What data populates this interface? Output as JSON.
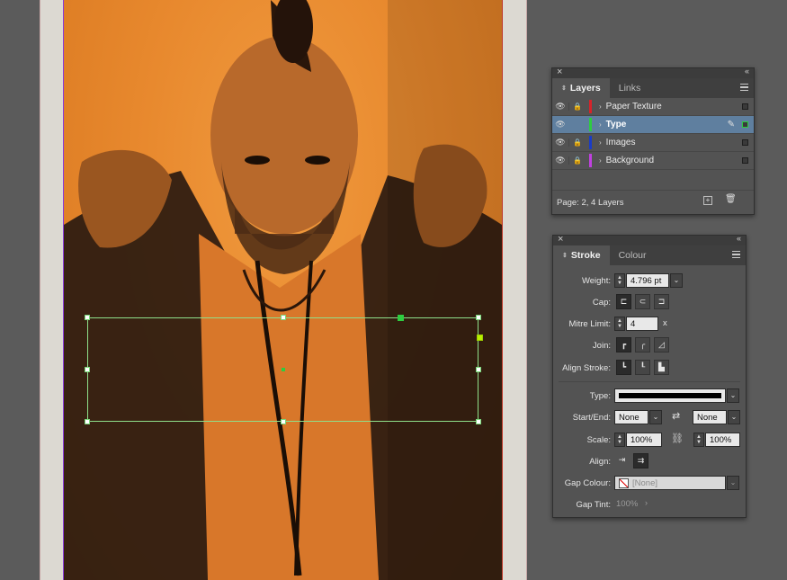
{
  "layers_panel": {
    "tabs": [
      "Layers",
      "Links"
    ],
    "active_tab": "Layers",
    "layers": [
      {
        "name": "Paper Texture",
        "color": "#d8232a",
        "visible": true,
        "locked": true,
        "selected": false
      },
      {
        "name": "Type",
        "color": "#2ecc40",
        "visible": true,
        "locked": false,
        "selected": true
      },
      {
        "name": "Images",
        "color": "#1a3cc8",
        "visible": true,
        "locked": true,
        "selected": false
      },
      {
        "name": "Background",
        "color": "#c040e0",
        "visible": true,
        "locked": true,
        "selected": false
      }
    ],
    "footer_text": "Page: 2, 4 Layers"
  },
  "stroke_panel": {
    "tabs": [
      "Stroke",
      "Colour"
    ],
    "active_tab": "Stroke",
    "weight_label": "Weight:",
    "weight_value": "4.796 pt",
    "cap_label": "Cap:",
    "mitre_label": "Mitre Limit:",
    "mitre_value": "4",
    "mitre_unit": "x",
    "join_label": "Join:",
    "align_stroke_label": "Align Stroke:",
    "type_label": "Type:",
    "start_end_label": "Start/End:",
    "start_value": "None",
    "end_value": "None",
    "scale_label": "Scale:",
    "scale_start": "100%",
    "scale_end": "100%",
    "align_label": "Align:",
    "gap_colour_label": "Gap Colour:",
    "gap_colour_value": "[None]",
    "gap_tint_label": "Gap Tint:",
    "gap_tint_value": "100%"
  },
  "colors": {
    "accent_selection": "#5f7f9f",
    "photo_orange": "#e8892e",
    "frame_green": "#8fe08a"
  }
}
